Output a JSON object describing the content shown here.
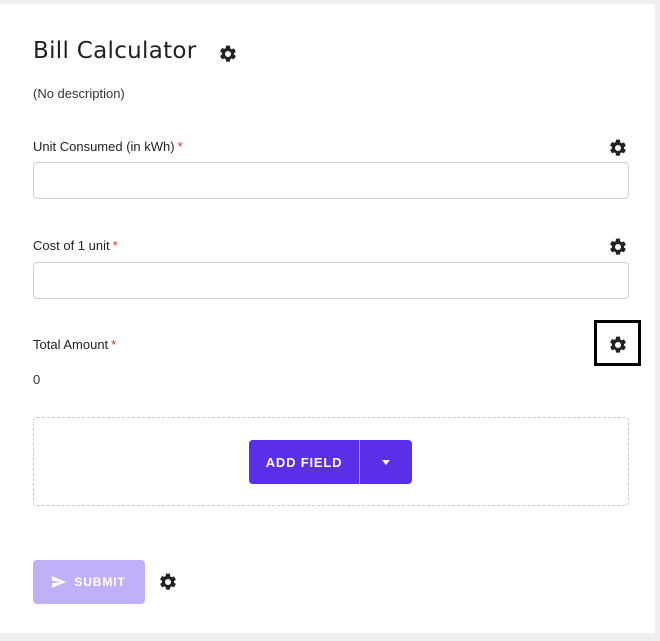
{
  "form": {
    "title": "Bill Calculator",
    "description": "(No description)"
  },
  "fields": [
    {
      "label": "Unit Consumed  (in kWh)",
      "required_mark": "*",
      "value": "",
      "placeholder": ""
    },
    {
      "label": "Cost of 1 unit",
      "required_mark": "*",
      "value": "",
      "placeholder": ""
    },
    {
      "label": "Total Amount",
      "required_mark": "*",
      "value": "0"
    }
  ],
  "toolbar": {
    "add_field_label": "ADD FIELD",
    "submit_label": "SUBMIT"
  },
  "icons": {
    "settings": "gear-icon",
    "dropdown": "chevron-down-icon",
    "send": "send-icon"
  },
  "colors": {
    "accent": "#5b2ee8",
    "submit_disabled": "#bfb0f7",
    "required": "#d32f2f"
  }
}
